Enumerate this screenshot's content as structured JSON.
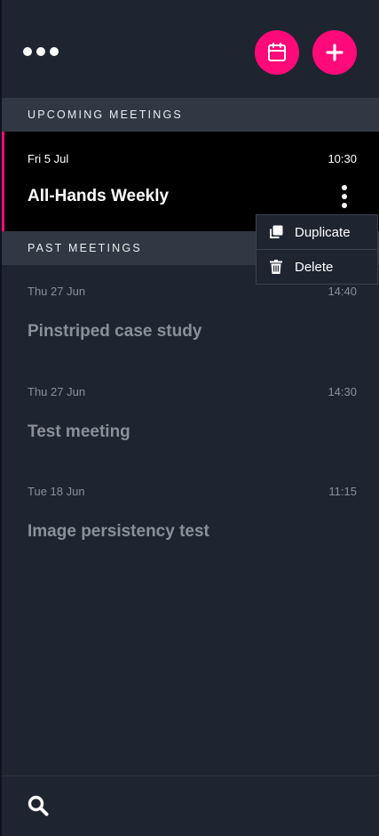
{
  "topbar": {
    "more_icon": "more-horizontal-icon",
    "calendar_icon": "calendar-icon",
    "add_icon": "plus-icon"
  },
  "colors": {
    "accent": "#ff0a78",
    "background": "#1e2530",
    "section_header_bg": "#303843",
    "active_bg": "#000000",
    "muted_text": "#8a9099"
  },
  "upcoming": {
    "header": "UPCOMING MEETINGS",
    "meetings": [
      {
        "date": "Fri 5 Jul",
        "time": "10:30",
        "title": "All-Hands Weekly"
      }
    ]
  },
  "past": {
    "header": "PAST MEETINGS",
    "meetings": [
      {
        "date": "Thu 27 Jun",
        "time": "14:40",
        "title": "Pinstriped case study"
      },
      {
        "date": "Thu 27 Jun",
        "time": "14:30",
        "title": "Test meeting"
      },
      {
        "date": "Tue 18 Jun",
        "time": "11:15",
        "title": "Image persistency test"
      }
    ]
  },
  "context_menu": {
    "items": [
      {
        "label": "Duplicate",
        "icon": "duplicate-icon"
      },
      {
        "label": "Delete",
        "icon": "trash-icon"
      }
    ]
  },
  "bottombar": {
    "search_icon": "search-icon"
  }
}
